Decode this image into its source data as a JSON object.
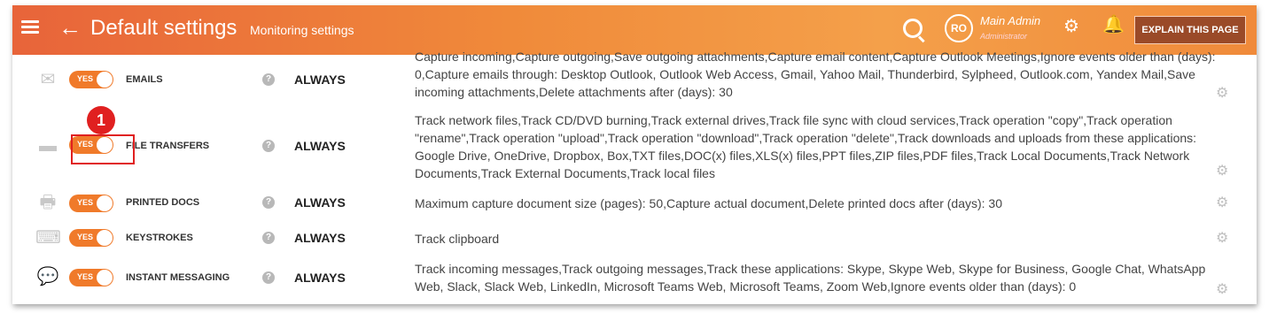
{
  "header": {
    "title": "Default settings",
    "subtitle": "Monitoring settings",
    "user_initials": "RO",
    "user_name": "Main Admin",
    "user_role": "Administrator",
    "explain_button": "EXPLAIN THIS PAGE",
    "icons": [
      "menu-icon",
      "back-arrow-icon",
      "search-icon",
      "gear-icon",
      "bell-icon"
    ]
  },
  "rows": [
    {
      "icon": "envelope-icon",
      "toggle": "YES",
      "name": "EMAILS",
      "help": "?",
      "frequency": "ALWAYS",
      "description": "Capture incoming,Capture outgoing,Save outgoing attachments,Capture email content,Capture Outlook Meetings,Ignore events older than (days): 0,Capture emails through: Desktop Outlook, Outlook Web Access, Gmail, Yahoo Mail, Thunderbird, Sylpheed, Outlook.com, Yandex Mail,Save incoming attachments,Delete attachments after (days): 30"
    },
    {
      "icon": "drive-icon",
      "toggle": "YES",
      "name": "FILE TRANSFERS",
      "help": "?",
      "frequency": "ALWAYS",
      "description": "Track network files,Track CD/DVD burning,Track external drives,Track file sync with cloud services,Track operation \"copy\",Track operation \"rename\",Track operation \"upload\",Track operation \"download\",Track operation \"delete\",Track downloads and uploads from these applications: Google Drive, OneDrive, Dropbox, Box,TXT files,DOC(x) files,XLS(x) files,PPT files,ZIP files,PDF files,Track Local Documents,Track Network Documents,Track External Documents,Track local files"
    },
    {
      "icon": "printer-icon",
      "toggle": "YES",
      "name": "PRINTED DOCS",
      "help": "?",
      "frequency": "ALWAYS",
      "description": "Maximum capture document size (pages): 50,Capture actual document,Delete printed docs after (days): 30"
    },
    {
      "icon": "keyboard-icon",
      "toggle": "YES",
      "name": "KEYSTROKES",
      "help": "?",
      "frequency": "ALWAYS",
      "description": "Track clipboard"
    },
    {
      "icon": "chat-bubble-icon",
      "toggle": "YES",
      "name": "INSTANT MESSAGING",
      "help": "?",
      "frequency": "ALWAYS",
      "description": "Track incoming messages,Track outgoing messages,Track these applications: Skype, Skype Web, Skype for Business, Google Chat, WhatsApp Web, Slack, Slack Web, LinkedIn, Microsoft Teams Web, Microsoft Teams, Zoom Web,Ignore events older than (days): 0"
    }
  ],
  "annotation": {
    "callout_number": "1",
    "callout_color": "#e02020"
  },
  "colors": {
    "header_gradient_start": "#e8643a",
    "header_gradient_end": "#f4a04a",
    "toggle_on": "#f07a2a",
    "explain_button_bg": "#9a4a28"
  }
}
